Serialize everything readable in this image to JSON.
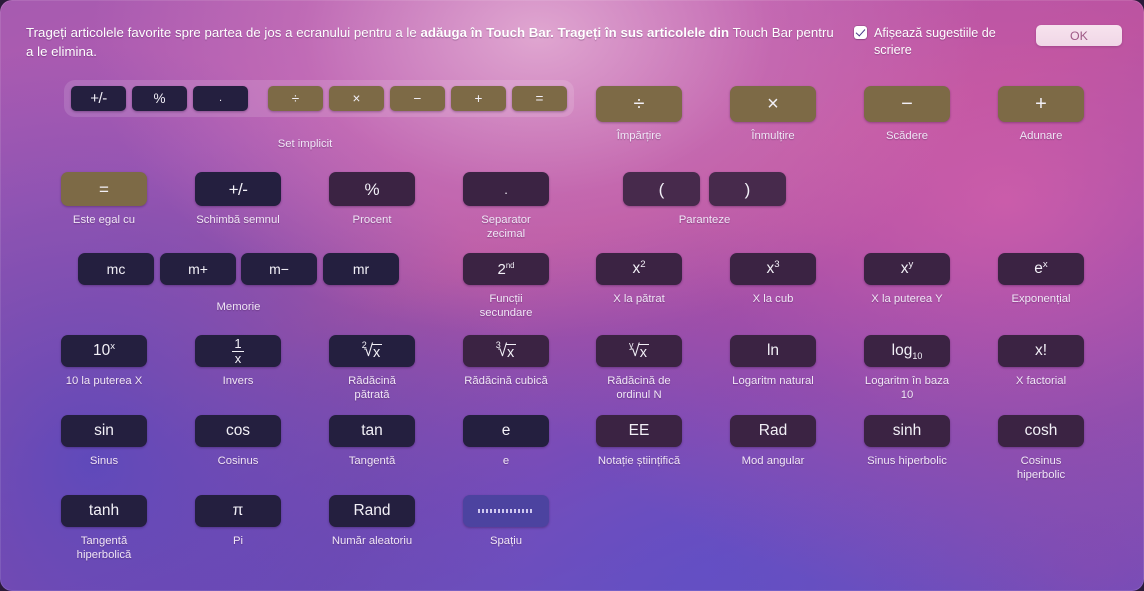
{
  "header": {
    "instructions_part1": "Trageți articolele favorite spre partea de jos a ecranului pentru a le ",
    "instructions_bold": "adăuga în Touch Bar. Trageți în sus articolele din",
    "instructions_part2": " Touch Bar pentru a le elimina.",
    "checkbox_label": "Afișează sugestiile de scriere",
    "checkbox_checked": true,
    "ok_label": "OK"
  },
  "colors": {
    "gold_key": "#7d6a46",
    "dark_key": "#241f3f",
    "plum_key": "#3b2343",
    "space_key": "#4c43a0",
    "ok_text": "#9e5a86"
  },
  "default_set": {
    "caption": "Set implicit",
    "keys": [
      {
        "glyph": "+/-",
        "style": "dark",
        "name": "toggle-sign-key"
      },
      {
        "glyph": "%",
        "style": "dark",
        "name": "percent-key"
      },
      {
        "glyph": ".",
        "style": "dark",
        "name": "decimal-key"
      },
      {
        "glyph": "÷",
        "style": "gold",
        "name": "divide-key"
      },
      {
        "glyph": "×",
        "style": "gold",
        "name": "multiply-key"
      },
      {
        "glyph": "−",
        "style": "gold",
        "name": "subtract-key"
      },
      {
        "glyph": "+",
        "style": "gold",
        "name": "add-key"
      },
      {
        "glyph": "=",
        "style": "gold",
        "name": "equals-key"
      }
    ]
  },
  "rows": [
    {
      "id": "row-operators",
      "items": [
        {
          "name": "divide-item",
          "glyph": "÷",
          "caption": "Împărțire",
          "style": "gold"
        },
        {
          "name": "multiply-item",
          "glyph": "×",
          "caption": "Înmulțire",
          "style": "gold"
        },
        {
          "name": "subtract-item",
          "glyph": "−",
          "caption": "Scădere",
          "style": "gold"
        },
        {
          "name": "add-item",
          "glyph": "+",
          "caption": "Adunare",
          "style": "gold"
        }
      ]
    },
    {
      "id": "row-basic",
      "items": [
        {
          "name": "equals-item",
          "glyph": "=",
          "caption": "Este egal cu",
          "style": "gold"
        },
        {
          "name": "toggle-sign-item",
          "glyph": "+/-",
          "caption": "Schimbă semnul",
          "style": "dark"
        },
        {
          "name": "percent-item",
          "glyph": "%",
          "caption": "Procent",
          "style": "plum"
        },
        {
          "name": "decimal-item",
          "glyph": ".",
          "caption": "Separator zecimal",
          "style": "plum"
        },
        {
          "name": "open-paren-item",
          "glyph": "(",
          "caption": "",
          "style": "plum-deep"
        },
        {
          "name": "close-paren-item",
          "glyph": ")",
          "caption": "",
          "style": "plum-deep"
        }
      ],
      "group_caption": "Paranteze"
    },
    {
      "id": "row-memory-powers",
      "items": [
        {
          "name": "memory-clear-item",
          "glyph": "mc",
          "caption": "",
          "style": "dark"
        },
        {
          "name": "memory-add-item",
          "glyph": "m+",
          "caption": "",
          "style": "dark"
        },
        {
          "name": "memory-subtract-item",
          "glyph": "m−",
          "caption": "",
          "style": "dark"
        },
        {
          "name": "memory-recall-item",
          "glyph": "mr",
          "caption": "",
          "style": "dark"
        },
        {
          "name": "second-functions-item",
          "glyph": "2nd",
          "caption": "Funcții\nsecundare",
          "style": "plum"
        },
        {
          "name": "x-squared-item",
          "glyph": "x²",
          "caption": "X la pătrat",
          "style": "plum"
        },
        {
          "name": "x-cubed-item",
          "glyph": "x³",
          "caption": "X la cub",
          "style": "plum"
        },
        {
          "name": "x-power-y-item",
          "glyph": "xʸ",
          "caption": "X la puterea Y",
          "style": "plum"
        },
        {
          "name": "e-power-x-item",
          "glyph": "eˣ",
          "caption": "Exponențial",
          "style": "plum"
        }
      ],
      "group_caption": "Memorie"
    },
    {
      "id": "row-roots-logs",
      "items": [
        {
          "name": "ten-power-x-item",
          "glyph": "10ˣ",
          "caption": "10 la puterea X",
          "style": "dark"
        },
        {
          "name": "inverse-item",
          "glyph": "1/x",
          "caption": "Invers",
          "style": "dark"
        },
        {
          "name": "square-root-item",
          "glyph": "²√x",
          "caption": "Rădăcină pătrată",
          "style": "dark"
        },
        {
          "name": "cube-root-item",
          "glyph": "³√x",
          "caption": "Rădăcină cubică",
          "style": "plum"
        },
        {
          "name": "nth-root-item",
          "glyph": "ʸ√x",
          "caption": "Rădăcină de ordinul N",
          "style": "plum"
        },
        {
          "name": "natural-log-item",
          "glyph": "ln",
          "caption": "Logaritm natural",
          "style": "plum"
        },
        {
          "name": "log-base-10-item",
          "glyph": "log10",
          "caption": "Logaritm în baza 10",
          "style": "plum"
        },
        {
          "name": "factorial-item",
          "glyph": "x!",
          "caption": "X factorial",
          "style": "plum"
        }
      ]
    },
    {
      "id": "row-trig",
      "items": [
        {
          "name": "sine-item",
          "glyph": "sin",
          "caption": "Sinus",
          "style": "dark"
        },
        {
          "name": "cosine-item",
          "glyph": "cos",
          "caption": "Cosinus",
          "style": "dark"
        },
        {
          "name": "tangent-item",
          "glyph": "tan",
          "caption": "Tangentă",
          "style": "dark"
        },
        {
          "name": "euler-item",
          "glyph": "e",
          "caption": "e",
          "style": "dark"
        },
        {
          "name": "scientific-notation-item",
          "glyph": "EE",
          "caption": "Notație științifică",
          "style": "plum"
        },
        {
          "name": "radian-mode-item",
          "glyph": "Rad",
          "caption": "Mod angular",
          "style": "plum"
        },
        {
          "name": "sinh-item",
          "glyph": "sinh",
          "caption": "Sinus hiperbolic",
          "style": "plum"
        },
        {
          "name": "cosh-item",
          "glyph": "cosh",
          "caption": "Cosinus hiperbolic",
          "style": "plum"
        }
      ]
    },
    {
      "id": "row-misc",
      "items": [
        {
          "name": "tanh-item",
          "glyph": "tanh",
          "caption": "Tangentă hiperbolică",
          "style": "dark"
        },
        {
          "name": "pi-item",
          "glyph": "π",
          "caption": "Pi",
          "style": "dark"
        },
        {
          "name": "random-item",
          "glyph": "Rand",
          "caption": "Număr aleatoriu",
          "style": "dark"
        },
        {
          "name": "space-item",
          "glyph": "",
          "caption": "Spațiu",
          "style": "space"
        }
      ]
    }
  ]
}
